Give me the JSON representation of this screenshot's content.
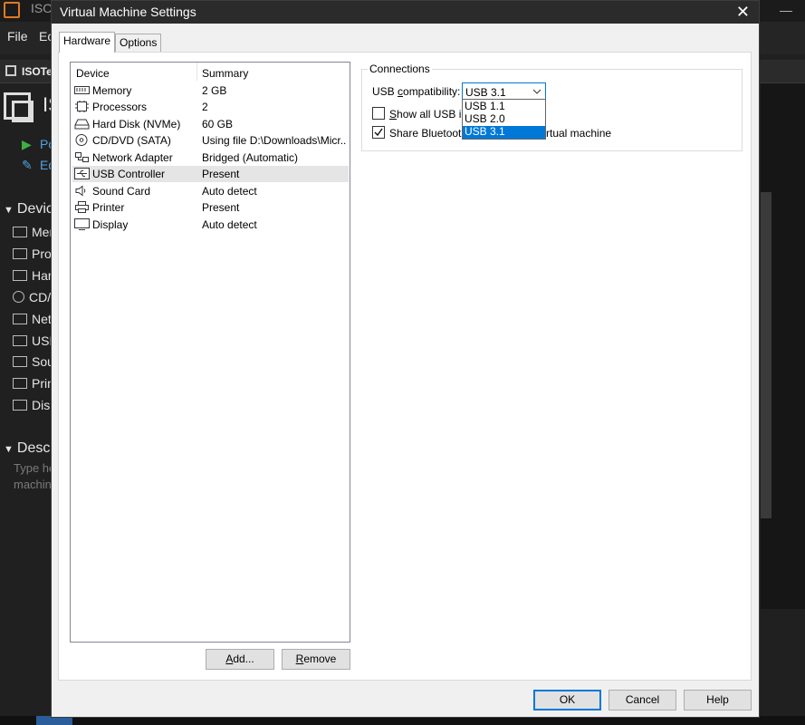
{
  "background": {
    "app_title": "ISO",
    "menu": [
      "File",
      "Ec"
    ],
    "vm_tab": "ISOTe",
    "vm_title": "IS",
    "commands": [
      "Po",
      "Ed"
    ],
    "devices_section": "Devic",
    "devices": [
      "Mer",
      "Proc",
      "Har",
      "CD/",
      "Net",
      "USE",
      "Sou",
      "Prin",
      "Disp"
    ],
    "description_section": "Descr",
    "description_placeholder": [
      "Type he",
      "machin"
    ]
  },
  "dialog": {
    "title": "Virtual Machine Settings",
    "close_glyph": "✕",
    "tabs": [
      {
        "label": "Hardware",
        "active": true
      },
      {
        "label": "Options",
        "active": false
      }
    ],
    "device_list": {
      "columns": [
        "Device",
        "Summary"
      ],
      "rows": [
        {
          "device": "Memory",
          "summary": "2 GB",
          "icon": "memory-icon"
        },
        {
          "device": "Processors",
          "summary": "2",
          "icon": "processor-icon"
        },
        {
          "device": "Hard Disk (NVMe)",
          "summary": "60 GB",
          "icon": "hard-disk-icon"
        },
        {
          "device": "CD/DVD (SATA)",
          "summary": "Using file D:\\Downloads\\Micr...",
          "icon": "cd-dvd-icon"
        },
        {
          "device": "Network Adapter",
          "summary": "Bridged (Automatic)",
          "icon": "network-adapter-icon"
        },
        {
          "device": "USB Controller",
          "summary": "Present",
          "icon": "usb-icon",
          "selected": true
        },
        {
          "device": "Sound Card",
          "summary": "Auto detect",
          "icon": "speaker-icon"
        },
        {
          "device": "Printer",
          "summary": "Present",
          "icon": "printer-icon"
        },
        {
          "device": "Display",
          "summary": "Auto detect",
          "icon": "monitor-icon"
        }
      ]
    },
    "add_button": {
      "label": "Add...",
      "mnemonic": "A",
      "rest": "dd..."
    },
    "remove_button": {
      "label": "Remove",
      "mnemonic": "R",
      "rest": "emove"
    },
    "connections": {
      "legend": "Connections",
      "usb_compat_label_pre": "USB ",
      "usb_compat_label_mn": "c",
      "usb_compat_label_post": "ompatibility:",
      "usb_compat_value": "USB 3.1",
      "options": [
        "USB 1.1",
        "USB 2.0",
        "USB 3.1"
      ],
      "highlighted_option": "USB 3.1",
      "show_all_pre": "",
      "show_all_mn": "S",
      "show_all_post": "how all USB inp",
      "show_all_checked": false,
      "share_bt_left": "Share Bluetooth",
      "share_bt_right": "rtual machine",
      "share_bt_checked": true
    },
    "footer": {
      "ok": "OK",
      "cancel": "Cancel",
      "help": "Help"
    }
  }
}
